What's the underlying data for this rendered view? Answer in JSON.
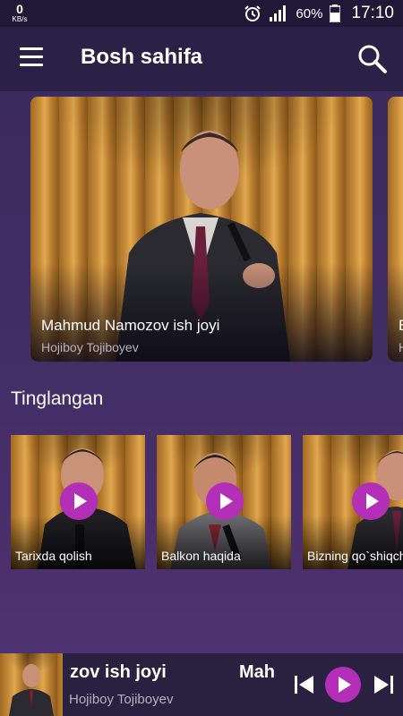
{
  "status_bar": {
    "speed_value": "0",
    "speed_unit": "KB/s",
    "battery_percent": "60%",
    "time": "17:10",
    "icons": [
      "alarm-icon",
      "signal-icon",
      "battery-icon"
    ]
  },
  "header": {
    "title": "Bosh sahifa",
    "menu_icon": "menu-icon",
    "search_icon": "search-icon"
  },
  "featured": [
    {
      "title": "Mahmud Namozov ish joyi",
      "subtitle": "Hojiboy Tojiboyev"
    },
    {
      "title": "B",
      "subtitle": "H"
    }
  ],
  "recent": {
    "title": "Tinglangan",
    "items": [
      {
        "label": "Tarixda qolish"
      },
      {
        "label": "Balkon haqida"
      },
      {
        "label": "Bizning qo`shiqchi"
      }
    ]
  },
  "player": {
    "title_visible": "zov ish joyi",
    "title_next": "Mah",
    "subtitle": "Hojiboy Tojiboyev",
    "controls": [
      "previous-icon",
      "play-icon",
      "next-icon"
    ]
  },
  "colors": {
    "accent": "#b42fb8",
    "app_bar": "#2b2046",
    "status_bar": "#1f1836",
    "background": "#412d64"
  }
}
